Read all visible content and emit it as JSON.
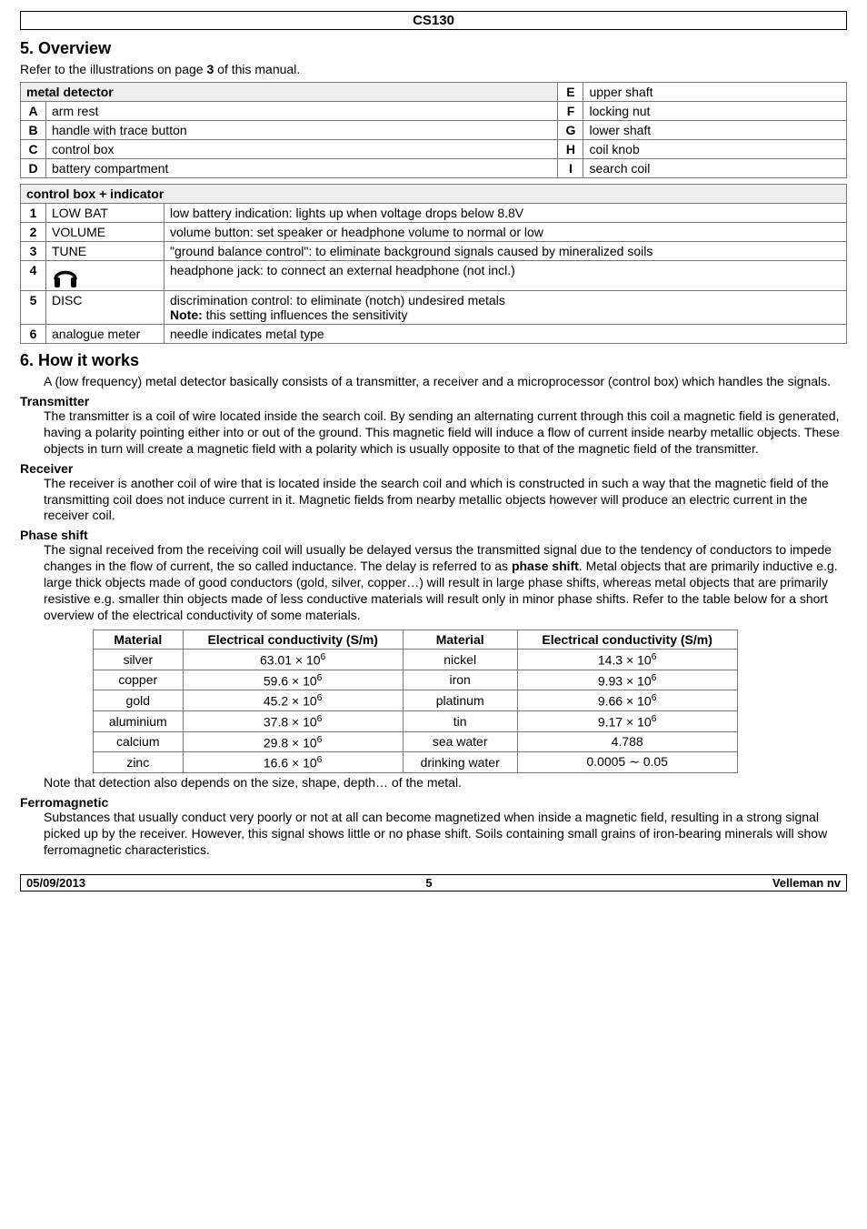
{
  "header": {
    "model": "CS130"
  },
  "sec5": {
    "title": "5. Overview",
    "intro_a": "Refer to the illustrations on page ",
    "intro_b": "3",
    "intro_c": " of this manual.",
    "parts_header": "metal detector",
    "parts": {
      "A": "arm rest",
      "E": "upper shaft",
      "B": "handle with trace button",
      "F": "locking nut",
      "C": "control box",
      "G": "lower shaft",
      "D": "battery compartment",
      "H": "coil knob",
      "I": "search coil"
    },
    "ctrl_header": "control box + indicator",
    "ctrl": [
      {
        "n": "1",
        "label": "LOW BAT",
        "desc": "low battery indication: lights up when voltage drops below 8.8V"
      },
      {
        "n": "2",
        "label": "VOLUME",
        "desc": "volume button: set speaker or headphone volume to normal or low"
      },
      {
        "n": "3",
        "label": "TUNE",
        "desc": "\"ground balance control\": to eliminate background signals caused by mineralized soils"
      },
      {
        "n": "4",
        "label": "__headphone__",
        "desc": "headphone jack: to connect an external headphone (not incl.)"
      },
      {
        "n": "5",
        "label": "DISC",
        "desc_a": "discrimination control: to eliminate (notch) undesired metals",
        "desc_b": "Note:",
        "desc_c": " this setting influences the sensitivity"
      },
      {
        "n": "6",
        "label": "analogue meter",
        "desc": "needle indicates metal type"
      }
    ]
  },
  "sec6": {
    "title": "6. How it works",
    "intro": "A (low frequency) metal detector basically consists of a transmitter, a receiver and a microprocessor (control box) which handles the signals.",
    "transmitter_h": "Transmitter",
    "transmitter": "The transmitter is a coil of wire located inside the search coil. By sending an alternating current through this coil a magnetic field is generated, having a polarity pointing either into or out of the ground. This magnetic field will induce a flow of current inside nearby metallic objects. These objects in turn will create a magnetic field with a polarity which is usually opposite to that of the magnetic field of the transmitter.",
    "receiver_h": "Receiver",
    "receiver": "The receiver is another coil of wire that is located inside the search coil and which is constructed in such a way that the magnetic field of the transmitting coil does not induce current in it. Magnetic fields from nearby metallic objects however will produce an electric current in the receiver coil.",
    "phase_h": "Phase shift",
    "phase_a": "The signal received from the receiving coil will usually be delayed versus the transmitted signal due to the tendency of conductors to impede changes in the flow of current, the so called inductance. The delay is referred to as ",
    "phase_b": "phase shift",
    "phase_c": ". Metal objects that are primarily inductive e.g. large thick objects made of good conductors (gold, silver, copper…) will result in large phase shifts, whereas metal objects that are primarily resistive e.g. smaller thin objects made of less conductive materials will result only in minor phase shifts. Refer to the table below for a short overview of the electrical conductivity of some materials.",
    "cond_headers": {
      "m": "Material",
      "e": "Electrical conductivity (S/m)"
    },
    "cond": [
      {
        "m1": "silver",
        "v1": "63.01 × 10",
        "m2": "nickel",
        "v2": "14.3 × 10"
      },
      {
        "m1": "copper",
        "v1": "59.6 × 10",
        "m2": "iron",
        "v2": "9.93 × 10"
      },
      {
        "m1": "gold",
        "v1": "45.2 × 10",
        "m2": "platinum",
        "v2": "9.66 × 10"
      },
      {
        "m1": "aluminium",
        "v1": "37.8 × 10",
        "m2": "tin",
        "v2": "9.17 × 10"
      },
      {
        "m1": "calcium",
        "v1": "29.8 × 10",
        "m2": "sea water",
        "v2": "4.788",
        "v2plain": true
      },
      {
        "m1": "zinc",
        "v1": "16.6 × 10",
        "m2": "drinking water",
        "v2": "0.0005  ∼  0.05",
        "v2plain": true
      }
    ],
    "note": "Note that detection also depends on the size, shape, depth… of the metal.",
    "ferro_h": "Ferromagnetic",
    "ferro": "Substances that usually conduct very poorly or not at all can become magnetized when inside a magnetic field, resulting in a strong signal picked up by the receiver. However, this signal shows little or no phase shift. Soils containing small grains of iron-bearing minerals will show ferromagnetic characteristics."
  },
  "chart_data": {
    "type": "table",
    "title": "Electrical conductivity (S/m)",
    "rows": [
      {
        "material": "silver",
        "value": 63010000.0
      },
      {
        "material": "copper",
        "value": 59600000.0
      },
      {
        "material": "gold",
        "value": 45200000.0
      },
      {
        "material": "aluminium",
        "value": 37800000.0
      },
      {
        "material": "calcium",
        "value": 29800000.0
      },
      {
        "material": "zinc",
        "value": 16600000.0
      },
      {
        "material": "nickel",
        "value": 14300000.0
      },
      {
        "material": "iron",
        "value": 9930000.0
      },
      {
        "material": "platinum",
        "value": 9660000.0
      },
      {
        "material": "tin",
        "value": 9170000.0
      },
      {
        "material": "sea water",
        "value": 4.788
      },
      {
        "material": "drinking water",
        "range": [
          0.0005,
          0.05
        ]
      }
    ]
  },
  "footer": {
    "date": "05/09/2013",
    "page": "5",
    "brand": "Velleman nv"
  }
}
